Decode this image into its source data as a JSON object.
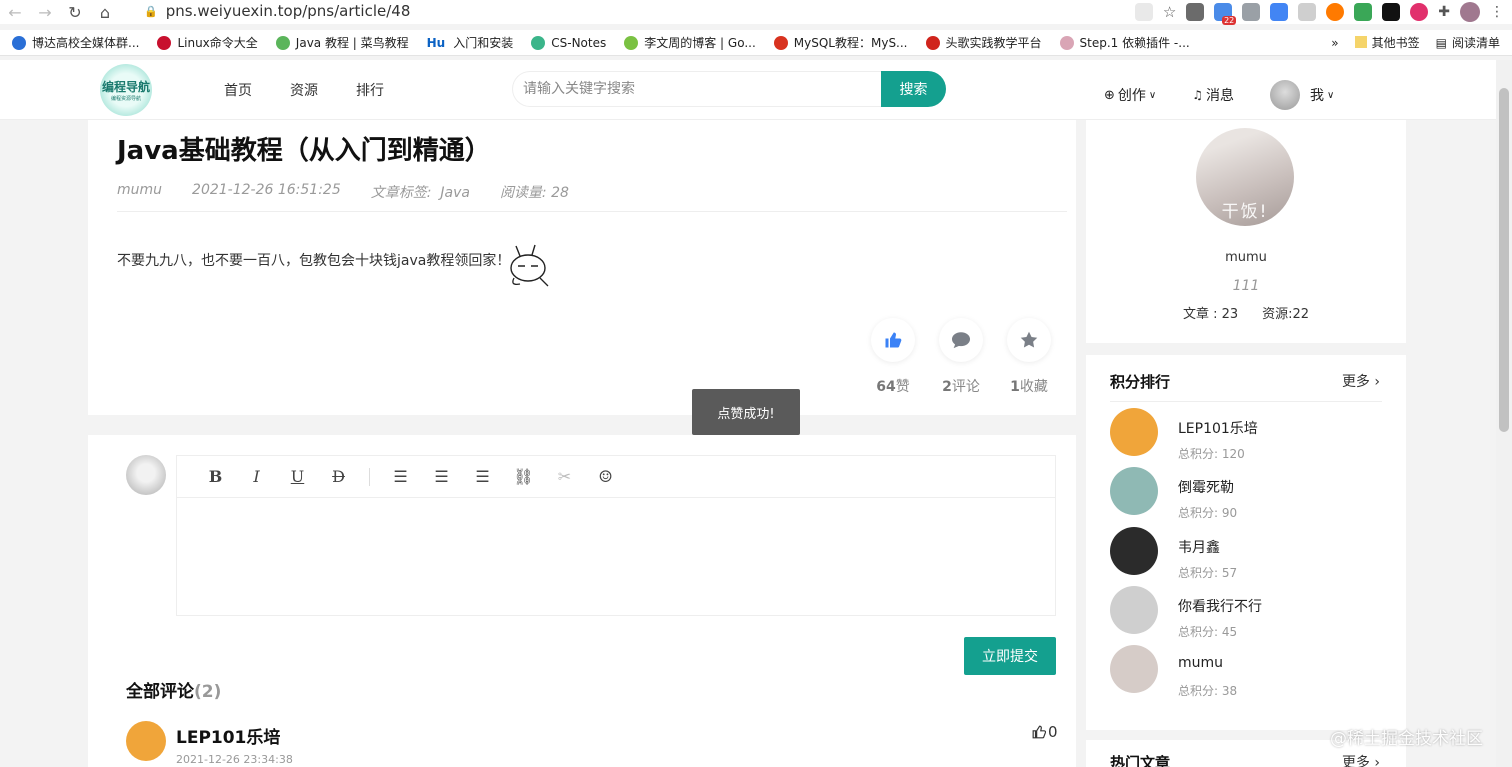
{
  "browser": {
    "url": "pns.weiyuexin.top/pns/article/48",
    "ext_badge": "22",
    "bookmarks": [
      {
        "label": "博达高校全媒体群...",
        "color": "#2a6fd6"
      },
      {
        "label": "Linux命令大全",
        "color": "#c8102e"
      },
      {
        "label": "Java 教程 | 菜鸟教程",
        "color": "#5bb55b"
      },
      {
        "label": "入门和安装",
        "color": "#0b62c4",
        "prefix": "Hu"
      },
      {
        "label": "CS-Notes",
        "color": "#3bb58a"
      },
      {
        "label": "李文周的博客 | Go...",
        "color": "#7ac142"
      },
      {
        "label": "MySQL教程：MyS...",
        "color": "#d8321f"
      },
      {
        "label": "头歌实践教学平台",
        "color": "#d0241c"
      },
      {
        "label": "Step.1 依赖插件 -...",
        "color": "#d9a5b5"
      }
    ],
    "bookmark_overflow": "»",
    "other_bookmarks": "其他书签",
    "reading_list": "阅读清单"
  },
  "header": {
    "logo_title": "编程导航",
    "logo_sub": "编程资源导航",
    "menu": [
      "首页",
      "资源",
      "排行"
    ],
    "search_placeholder": "请输入关键字搜索",
    "search_button": "搜索",
    "create": "创作",
    "messages": "消息",
    "me": "我"
  },
  "article": {
    "title": "Java基础教程（从入门到精通）",
    "author": "mumu",
    "date": "2021-12-26 16:51:25",
    "tags_label": "文章标签:",
    "tag": "Java",
    "views": "阅读量: 28",
    "body": "不要九九八，也不要一百八，包教包会十块钱java教程领回家！",
    "likes_count": "64",
    "likes_label": "赞",
    "comments_count": "2",
    "comments_label": "评论",
    "favs_count": "1",
    "favs_label": "收藏"
  },
  "toast": "点赞成功!",
  "comment_editor": {
    "tools": [
      "B",
      "I",
      "U",
      "D"
    ],
    "submit": "立即提交"
  },
  "comments": {
    "header": "全部评论",
    "count": "(2)",
    "first": {
      "name": "LEP101乐培",
      "date": "2021-12-26 23:34:38",
      "likes": "0"
    }
  },
  "profile": {
    "name": "mumu",
    "signature": "111",
    "avatar_caption": "干饭!",
    "articles": "文章 : 23",
    "resources": "资源:22"
  },
  "ranking": {
    "title": "积分排行",
    "more": "更多",
    "items": [
      {
        "name": "LEP101乐培",
        "score": "总积分:  120",
        "color": "#f0a53a"
      },
      {
        "name": "倒霉死勒",
        "score": "总积分:  90",
        "color": "#8fb9b4"
      },
      {
        "name": "韦月鑫",
        "score": "总积分:  57",
        "color": "#2b2b2b"
      },
      {
        "name": "你看我行不行",
        "score": "总积分:  45",
        "color": "#cfcfcf"
      },
      {
        "name": "mumu",
        "score": "总积分:  38",
        "color": "#d6ccc8"
      }
    ]
  },
  "hot": {
    "title": "热门文章",
    "more": "更多"
  },
  "watermark": "@稀土掘金技术社区"
}
